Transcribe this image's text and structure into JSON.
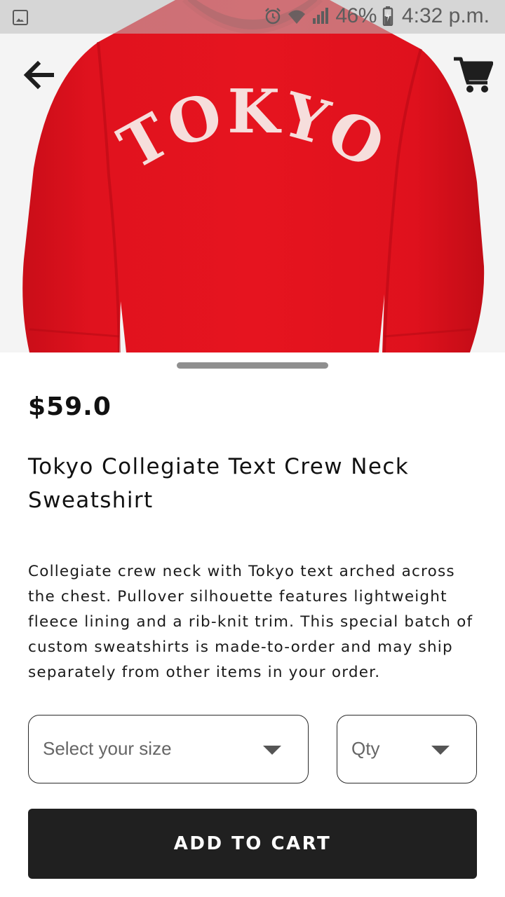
{
  "status_bar": {
    "battery_percent": "46%",
    "time": "4:32 p.m.",
    "icons": [
      "gallery-icon",
      "alarm-icon",
      "wifi-icon",
      "signal-icon",
      "battery-charging-icon"
    ]
  },
  "nav": {
    "back_icon": "arrow-left-icon",
    "cart_icon": "shopping-cart-icon"
  },
  "product": {
    "image_text": "TOKYO",
    "garment_color": "#e4121e",
    "price": "$59.0",
    "title": "Tokyo Collegiate Text Crew Neck Sweatshirt",
    "description": "Collegiate crew neck with Tokyo text arched across the chest. Pullover silhouette features lightweight fleece lining and a rib-knit trim. This special batch of custom sweatshirts is made-to-order and may ship separately from other items in your order."
  },
  "options": {
    "size_placeholder": "Select your size",
    "qty_placeholder": "Qty"
  },
  "actions": {
    "add_to_cart_label": "ADD TO CART"
  },
  "colors": {
    "button_bg": "#202020",
    "text": "#111111",
    "handle": "#8f8f8f"
  }
}
